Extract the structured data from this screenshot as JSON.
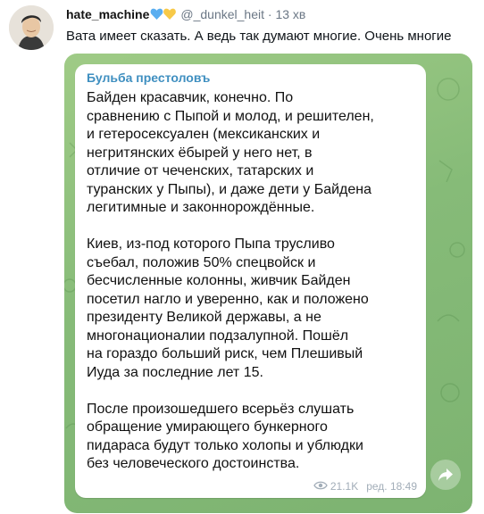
{
  "tweet": {
    "username": "hate_machine",
    "handle": "@_dunkel_heit",
    "separator": "·",
    "time": "13 хв",
    "text": "Вата имеет сказать. А ведь так думают многие. Очень многие"
  },
  "post": {
    "channel": "Бульба престоловъ",
    "paragraphs": [
      "Байден красавчик, конечно. По\nсравнению с Пыпой и молод, и решителен,\nи гетеросексуален (мексиканских и\nнегритянских ёбырей у него нет, в\nотличие от чеченских, татарских и\nтуранских у Пыпы), и даже дети у Байдена\nлегитимные и законнорождённые.",
      "Киев, из-под которого Пыпа трусливо\nсъебал, положив 50% спецвойск и\nбесчисленные колонны, живчик Байден\nпосетил нагло и уверенно, как и положено\nпрезиденту Великой державы, а не\nмногонационалии подзалупной. Пошёл\nна гораздо больший риск, чем Плешивый\nИуда за последние лет 15.",
      "После произошедшего всерьёз слушать\nобращение умирающего бункерного\nпидараса будут только холопы и ублюдки\nбез человеческого достоинства."
    ],
    "views": "21.1K",
    "edited_time": "ред. 18:49"
  },
  "colors": {
    "channel_name": "#3f8fc0",
    "background_green": "#8fc27e",
    "heart_blue": "#5aaef0",
    "heart_yellow": "#f7c948"
  },
  "icons": [
    "avatar",
    "blue-heart-icon",
    "yellow-heart-icon",
    "eye-icon",
    "share-arrow-icon"
  ]
}
